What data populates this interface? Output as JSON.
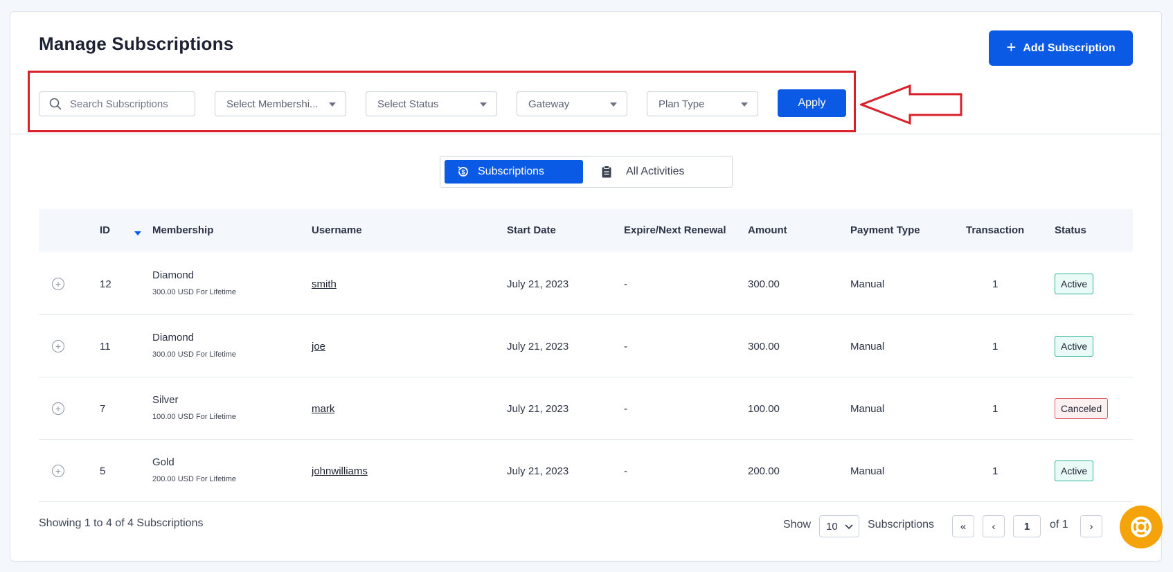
{
  "header": {
    "title": "Manage Subscriptions",
    "add_label": "Add Subscription"
  },
  "filters": {
    "search_placeholder": "Search Subscriptions",
    "membership": "Select Membershi...",
    "status": "Select Status",
    "gateway": "Gateway",
    "plan_type": "Plan Type",
    "apply_label": "Apply"
  },
  "annotation": {
    "highlight_color": "#d81f2a"
  },
  "tabs": [
    {
      "label": "Subscriptions",
      "active": true
    },
    {
      "label": "All Activities",
      "active": false
    }
  ],
  "table": {
    "columns": [
      "ID",
      "Membership",
      "Username",
      "Start Date",
      "Expire/Next Renewal",
      "Amount",
      "Payment Type",
      "Transaction",
      "Status"
    ],
    "rows": [
      {
        "id": "12",
        "plan": "Diamond",
        "plan_detail": "300.00 USD For Lifetime",
        "username": "smith",
        "start": "July 21, 2023",
        "expire": "-",
        "amount": "300.00",
        "payment": "Manual",
        "transaction": "1",
        "status": "Active"
      },
      {
        "id": "11",
        "plan": "Diamond",
        "plan_detail": "300.00 USD For Lifetime",
        "username": "joe",
        "start": "July 21, 2023",
        "expire": "-",
        "amount": "300.00",
        "payment": "Manual",
        "transaction": "1",
        "status": "Active"
      },
      {
        "id": "7",
        "plan": "Silver",
        "plan_detail": "100.00 USD For Lifetime",
        "username": "mark",
        "start": "July 21, 2023",
        "expire": "-",
        "amount": "100.00",
        "payment": "Manual",
        "transaction": "1",
        "status": "Canceled"
      },
      {
        "id": "5",
        "plan": "Gold",
        "plan_detail": "200.00 USD For Lifetime",
        "username": "johnwilliams",
        "start": "July 21, 2023",
        "expire": "-",
        "amount": "200.00",
        "payment": "Manual",
        "transaction": "1",
        "status": "Active"
      }
    ]
  },
  "footer": {
    "summary": "Showing 1 to 4 of 4 Subscriptions",
    "show_label": "Show",
    "per_page": "10",
    "per_page_suffix": "Subscriptions",
    "first": "«",
    "prev": "‹",
    "page": "1",
    "of_label": "of 1",
    "next": "›"
  },
  "colors": {
    "primary": "#0b5ae5",
    "active": "#2db39a",
    "canceled": "#e05a64",
    "help": "#f4a40a"
  }
}
